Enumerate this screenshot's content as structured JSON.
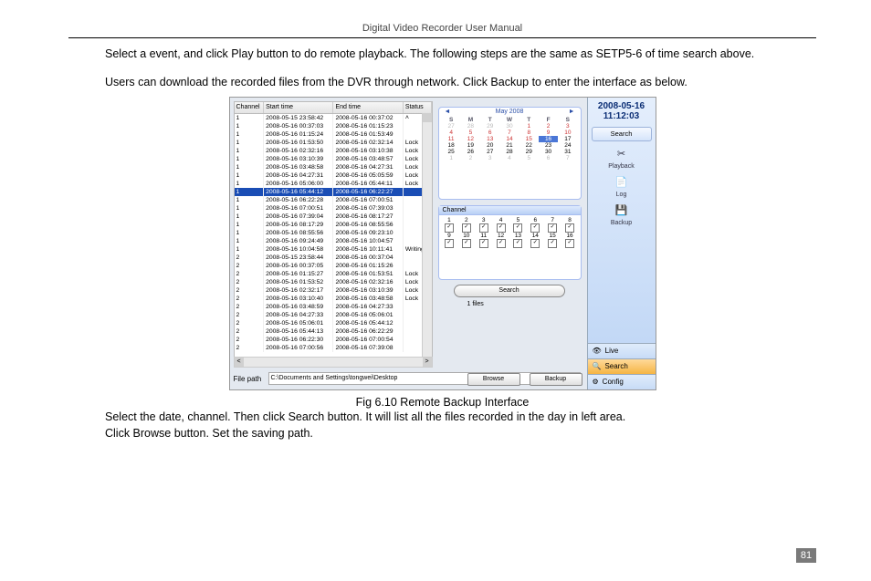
{
  "header": {
    "title": "Digital Video Recorder User Manual"
  },
  "text": {
    "p1": "Select a event, and click Play button to do remote playback. The following steps are the same as SETP5-6 of time search above.",
    "p2": "Users can download the recorded files from the DVR through network. Click Backup to enter the interface as below.",
    "figcap": "Fig 6.10    Remote Backup Interface",
    "p3": "Select the date, channel. Then click Search button. It will list all the files recorded in the day in left area.",
    "p4": "Click Browse button. Set the saving path."
  },
  "page_number": "81",
  "screenshot": {
    "list": {
      "headers": {
        "channel": "Channel",
        "start": "Start time",
        "end": "End time",
        "status": "Status ˄"
      },
      "rows": [
        {
          "ch": "1",
          "st": "2008-05-15 23:58:42",
          "et": "2008-05-16 00:37:02",
          "sta": ""
        },
        {
          "ch": "1",
          "st": "2008-05-16 00:37:03",
          "et": "2008-05-16 01:15:23",
          "sta": ""
        },
        {
          "ch": "1",
          "st": "2008-05-16 01:15:24",
          "et": "2008-05-16 01:53:49",
          "sta": ""
        },
        {
          "ch": "1",
          "st": "2008-05-16 01:53:50",
          "et": "2008-05-16 02:32:14",
          "sta": "Lock"
        },
        {
          "ch": "1",
          "st": "2008-05-16 02:32:16",
          "et": "2008-05-16 03:10:38",
          "sta": "Lock"
        },
        {
          "ch": "1",
          "st": "2008-05-16 03:10:39",
          "et": "2008-05-16 03:48:57",
          "sta": "Lock"
        },
        {
          "ch": "1",
          "st": "2008-05-16 03:48:58",
          "et": "2008-05-16 04:27:31",
          "sta": "Lock"
        },
        {
          "ch": "1",
          "st": "2008-05-16 04:27:31",
          "et": "2008-05-16 05:05:59",
          "sta": "Lock"
        },
        {
          "ch": "1",
          "st": "2008-05-16 05:06:00",
          "et": "2008-05-16 05:44:11",
          "sta": "Lock"
        },
        {
          "ch": "1",
          "st": "2008-05-16 05:44:12",
          "et": "2008-05-16 06:22:27",
          "sta": "",
          "sel": true
        },
        {
          "ch": "1",
          "st": "2008-05-16 06:22:28",
          "et": "2008-05-16 07:00:51",
          "sta": ""
        },
        {
          "ch": "1",
          "st": "2008-05-16 07:00:51",
          "et": "2008-05-16 07:39:03",
          "sta": ""
        },
        {
          "ch": "1",
          "st": "2008-05-16 07:39:04",
          "et": "2008-05-16 08:17:27",
          "sta": ""
        },
        {
          "ch": "1",
          "st": "2008-05-16 08:17:29",
          "et": "2008-05-16 08:55:56",
          "sta": ""
        },
        {
          "ch": "1",
          "st": "2008-05-16 08:55:56",
          "et": "2008-05-16 09:23:10",
          "sta": ""
        },
        {
          "ch": "1",
          "st": "2008-05-16 09:24:49",
          "et": "2008-05-16 10:04:57",
          "sta": ""
        },
        {
          "ch": "1",
          "st": "2008-05-16 10:04:58",
          "et": "2008-05-16 10:11:41",
          "sta": "Writing"
        },
        {
          "ch": "2",
          "st": "2008-05-15 23:58:44",
          "et": "2008-05-16 00:37:04",
          "sta": ""
        },
        {
          "ch": "2",
          "st": "2008-05-16 00:37:05",
          "et": "2008-05-16 01:15:26",
          "sta": ""
        },
        {
          "ch": "2",
          "st": "2008-05-16 01:15:27",
          "et": "2008-05-16 01:53:51",
          "sta": "Lock"
        },
        {
          "ch": "2",
          "st": "2008-05-16 01:53:52",
          "et": "2008-05-16 02:32:16",
          "sta": "Lock"
        },
        {
          "ch": "2",
          "st": "2008-05-16 02:32:17",
          "et": "2008-05-16 03:10:39",
          "sta": "Lock"
        },
        {
          "ch": "2",
          "st": "2008-05-16 03:10:40",
          "et": "2008-05-16 03:48:58",
          "sta": "Lock"
        },
        {
          "ch": "2",
          "st": "2008-05-16 03:48:59",
          "et": "2008-05-16 04:27:33",
          "sta": ""
        },
        {
          "ch": "2",
          "st": "2008-05-16 04:27:33",
          "et": "2008-05-16 05:06:01",
          "sta": ""
        },
        {
          "ch": "2",
          "st": "2008-05-16 05:06:01",
          "et": "2008-05-16 05:44:12",
          "sta": ""
        },
        {
          "ch": "2",
          "st": "2008-05-16 05:44:13",
          "et": "2008-05-16 06:22:29",
          "sta": ""
        },
        {
          "ch": "2",
          "st": "2008-05-16 06:22:30",
          "et": "2008-05-16 07:00:54",
          "sta": ""
        },
        {
          "ch": "2",
          "st": "2008-05-16 07:00:56",
          "et": "2008-05-16 07:39:08",
          "sta": ""
        }
      ]
    },
    "calendar": {
      "prev": "◄",
      "next": "►",
      "title": "May 2008",
      "dayheads": [
        "S",
        "M",
        "T",
        "W",
        "T",
        "F",
        "S"
      ],
      "days": [
        {
          "n": "27",
          "c": "dim"
        },
        {
          "n": "28",
          "c": "dim"
        },
        {
          "n": "29",
          "c": "dim"
        },
        {
          "n": "30",
          "c": "dim"
        },
        {
          "n": "1",
          "c": "red"
        },
        {
          "n": "2",
          "c": "red"
        },
        {
          "n": "3",
          "c": "red"
        },
        {
          "n": "4",
          "c": "red"
        },
        {
          "n": "5",
          "c": "red"
        },
        {
          "n": "6",
          "c": "red"
        },
        {
          "n": "7",
          "c": "red"
        },
        {
          "n": "8",
          "c": "red"
        },
        {
          "n": "9",
          "c": "red"
        },
        {
          "n": "10",
          "c": "red"
        },
        {
          "n": "11",
          "c": "red"
        },
        {
          "n": "12",
          "c": "red"
        },
        {
          "n": "13",
          "c": "red"
        },
        {
          "n": "14",
          "c": "red"
        },
        {
          "n": "15",
          "c": "red"
        },
        {
          "n": "16",
          "c": "sel"
        },
        {
          "n": "17",
          "c": ""
        },
        {
          "n": "18",
          "c": ""
        },
        {
          "n": "19",
          "c": ""
        },
        {
          "n": "20",
          "c": ""
        },
        {
          "n": "21",
          "c": ""
        },
        {
          "n": "22",
          "c": ""
        },
        {
          "n": "23",
          "c": ""
        },
        {
          "n": "24",
          "c": ""
        },
        {
          "n": "25",
          "c": ""
        },
        {
          "n": "26",
          "c": ""
        },
        {
          "n": "27",
          "c": ""
        },
        {
          "n": "28",
          "c": ""
        },
        {
          "n": "29",
          "c": ""
        },
        {
          "n": "30",
          "c": ""
        },
        {
          "n": "31",
          "c": ""
        },
        {
          "n": "1",
          "c": "dim"
        },
        {
          "n": "2",
          "c": "dim"
        },
        {
          "n": "3",
          "c": "dim"
        },
        {
          "n": "4",
          "c": "dim"
        },
        {
          "n": "5",
          "c": "dim"
        },
        {
          "n": "6",
          "c": "dim"
        },
        {
          "n": "7",
          "c": "dim"
        }
      ]
    },
    "channel_panel": {
      "title": "Channel",
      "items": [
        "1",
        "2",
        "3",
        "4",
        "5",
        "6",
        "7",
        "8",
        "9",
        "10",
        "11",
        "12",
        "13",
        "14",
        "15",
        "16"
      ],
      "check": "✓"
    },
    "search_btn": "Search",
    "files_label": "1 files",
    "browse_btn": "Browse",
    "backup_btn": "Backup",
    "filepath": {
      "label": "File path",
      "value": "C:\\Documents and Settings\\tongwei\\Desktop"
    },
    "side": {
      "date": "2008-05-16",
      "time": "11:12:03",
      "search_btn": "Search",
      "icons": [
        {
          "glyph": "✂",
          "label": "Playback"
        },
        {
          "glyph": "📄",
          "label": "Log"
        },
        {
          "glyph": "💾",
          "label": "Backup"
        }
      ],
      "nav": [
        {
          "glyph": "👁",
          "label": "Live",
          "cls": "live"
        },
        {
          "glyph": "🔍",
          "label": "Search",
          "cls": "search"
        },
        {
          "glyph": "⚙",
          "label": "Config",
          "cls": "config"
        }
      ]
    }
  }
}
